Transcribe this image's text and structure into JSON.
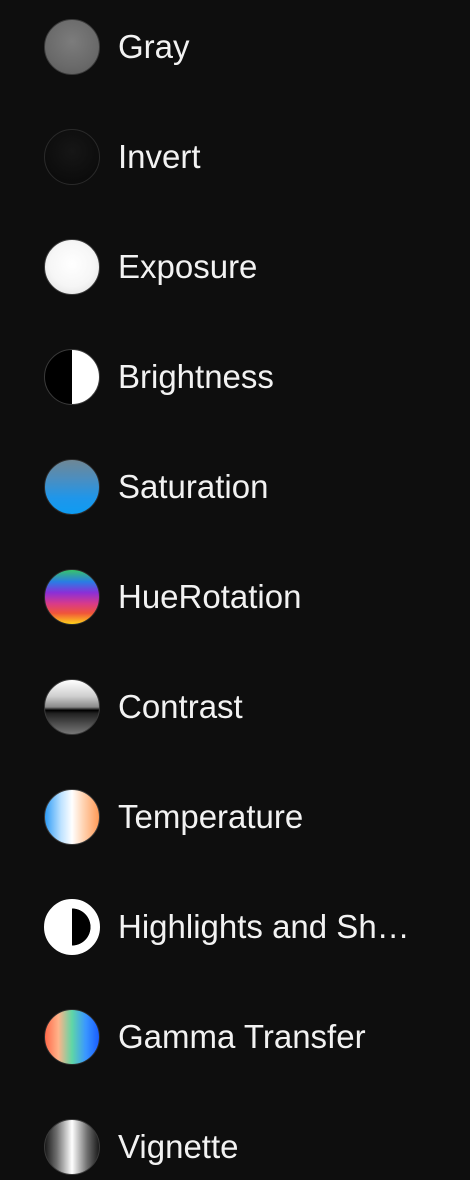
{
  "effects": {
    "items": [
      {
        "label": "Gray",
        "icon": "gray-swatch-icon"
      },
      {
        "label": "Invert",
        "icon": "invert-swatch-icon"
      },
      {
        "label": "Exposure",
        "icon": "exposure-swatch-icon"
      },
      {
        "label": "Brightness",
        "icon": "brightness-swatch-icon"
      },
      {
        "label": "Saturation",
        "icon": "saturation-swatch-icon"
      },
      {
        "label": "HueRotation",
        "icon": "hue-rotation-swatch-icon"
      },
      {
        "label": "Contrast",
        "icon": "contrast-swatch-icon"
      },
      {
        "label": "Temperature",
        "icon": "temperature-swatch-icon"
      },
      {
        "label": "Highlights and Sh…",
        "icon": "highlights-shadows-swatch-icon"
      },
      {
        "label": "Gamma Transfer",
        "icon": "gamma-transfer-swatch-icon"
      },
      {
        "label": "Vignette",
        "icon": "vignette-swatch-icon"
      }
    ]
  },
  "colors": {
    "background": "#0e0e0e",
    "text": "#f2f2f2"
  }
}
